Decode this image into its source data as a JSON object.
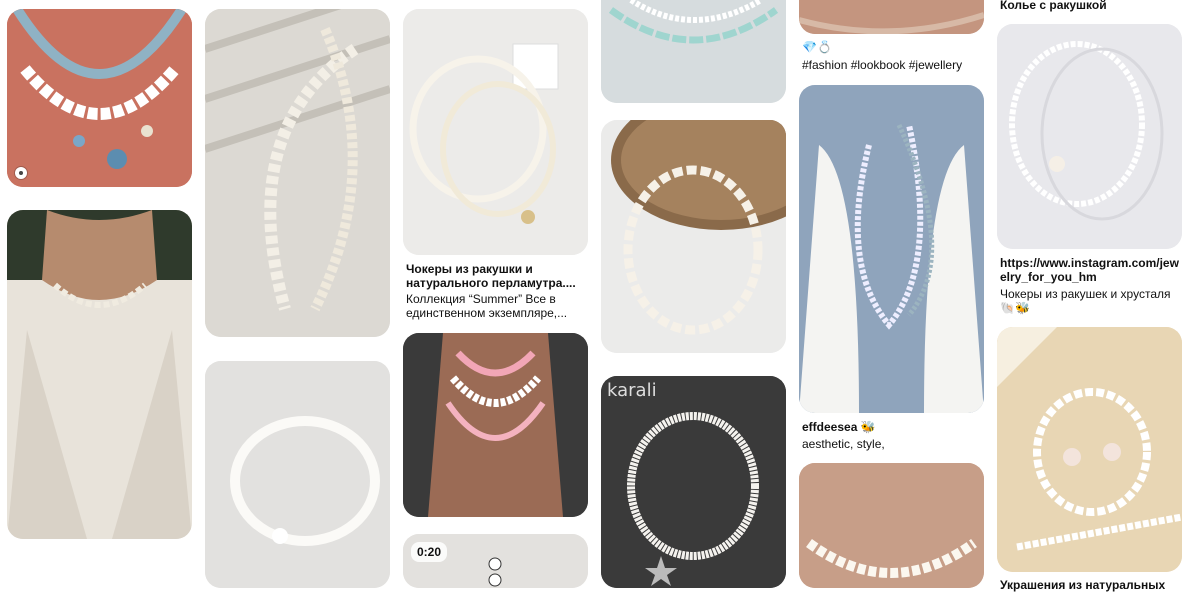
{
  "pins": {
    "p1": {
      "label": "Necklace with shell and sea charms"
    },
    "p2": {
      "label": "Pearl and shell necklace"
    },
    "p3": {
      "label": "Shell necklace on white fabric"
    },
    "p4": {
      "label": "Chokers set with starfish",
      "title": "Чокеры из ракушки и натурального перламутра....",
      "desc": "Коллекция “Summer” Все в единственном экземпляре,..."
    },
    "p5": {
      "label": "Pink layered necklaces"
    },
    "p6": {
      "label": "Video pin",
      "badge": "0:20"
    },
    "p7": {
      "label": "Seahorse necklace"
    },
    "p8": {
      "label": "Heishi necklace by mirror"
    },
    "p9": {
      "label": "Starfish necklace",
      "brand": "karali"
    },
    "p10": {
      "label": "Neck closeup",
      "emojis": "💎💍",
      "desc": "#fashion #lookbook #jewellery"
    },
    "p11": {
      "label": "Pearl necklaces on tank top",
      "title": "effdeesea 🐝",
      "desc": "aesthetic, style,"
    },
    "p12": {
      "label": "Choker on neck"
    },
    "p13": {
      "label": "Shell pendant necklaces",
      "top_text": "Колье с ракушкой",
      "title": "https://www.instagram.com/jewelry_for_you_hm",
      "desc": "Чокеры из ракушек и хрусталя 🐚🐝"
    },
    "p14": {
      "label": "Necklaces and earrings",
      "title": "Украшения из натуральных"
    }
  },
  "colors": {
    "text": "#111111",
    "bg": "#ffffff"
  }
}
